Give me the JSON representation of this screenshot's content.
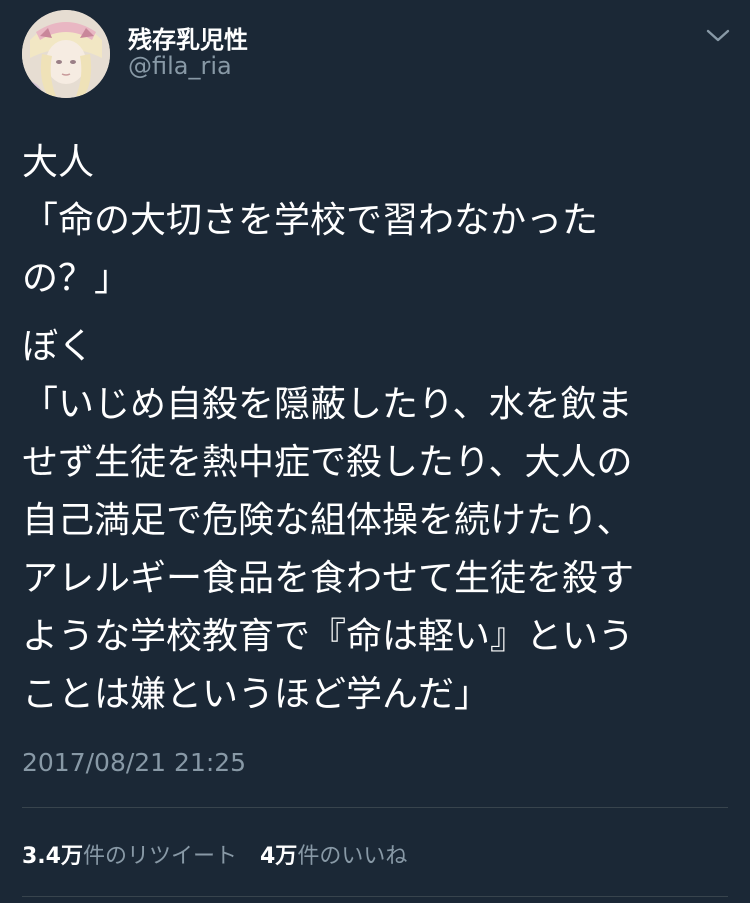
{
  "author": {
    "display_name": "残存乳児性",
    "handle": "@fila_ria"
  },
  "tweet": {
    "paragraphs": [
      "大人\n「命の大切さを学校で習わなかった\nの？」",
      "ぼく\n「いじめ自殺を隠蔽したり、水を飲ま\nせず生徒を熱中症で殺したり、大人の\n自己満足で危険な組体操を続けたり、\nアレルギー食品を食わせて生徒を殺す\nような学校教育で『命は軽い』という\nことは嫌というほど学んだ」"
    ],
    "timestamp": "2017/08/21 21:25"
  },
  "stats": {
    "retweets": {
      "count": "3.4万",
      "label": "件のリツイート"
    },
    "likes": {
      "count": "4万",
      "label": "件のいいね"
    }
  },
  "icons": {
    "menu": "chevron-down-icon",
    "avatar": "avatar"
  },
  "colors": {
    "background": "#1b2836",
    "text": "#ffffff",
    "secondary_text": "#8899a6",
    "divider": "#38444d"
  }
}
